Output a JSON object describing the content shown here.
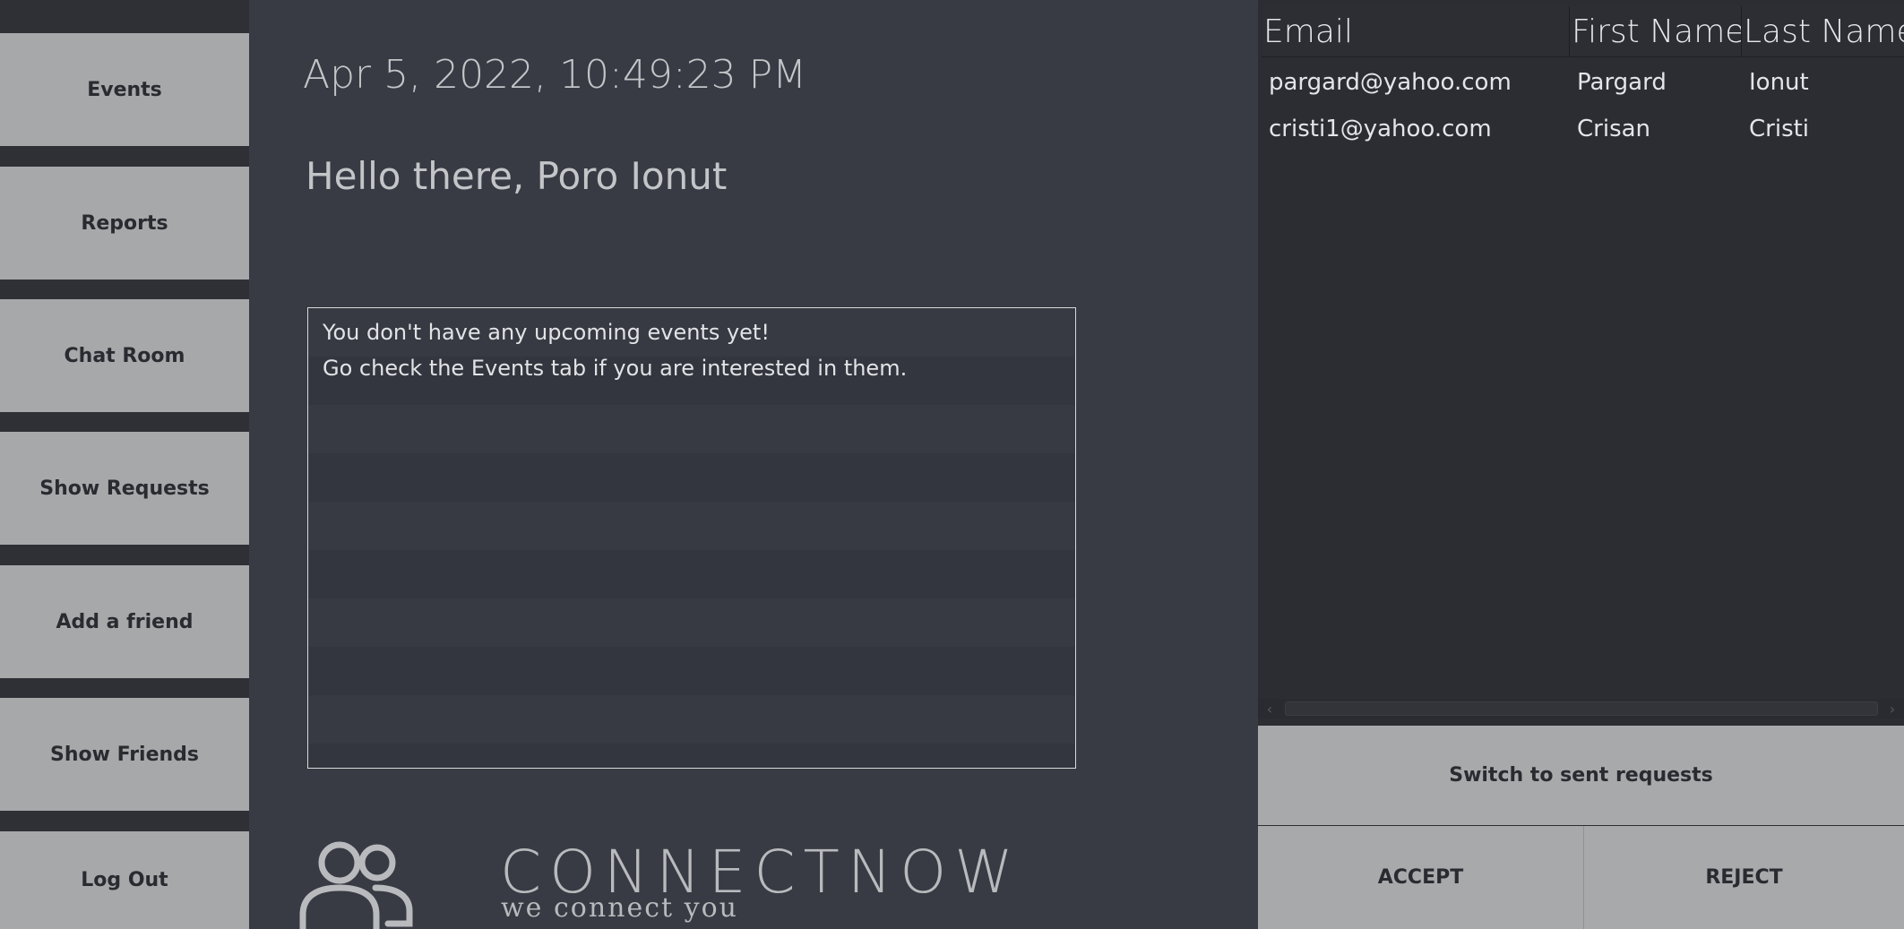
{
  "sidebar": {
    "items": [
      {
        "label": "Events"
      },
      {
        "label": "Reports"
      },
      {
        "label": "Chat Room"
      },
      {
        "label": "Show Requests"
      },
      {
        "label": "Add a friend"
      },
      {
        "label": "Show Friends"
      },
      {
        "label": "Log Out"
      }
    ]
  },
  "main": {
    "datetime": "Apr 5, 2022, 10:49:23 PM",
    "greeting": "Hello there, Poro Ionut",
    "events_message": [
      "You don't have any upcoming events yet!",
      "Go check the Events tab if you are interested in them."
    ]
  },
  "logo": {
    "name": "CONNECTNOW",
    "tagline": "we connect you",
    "icon": "people-icon"
  },
  "requests": {
    "columns": [
      "Email",
      "First Name",
      "Last Name"
    ],
    "rows": [
      [
        "pargard@yahoo.com",
        "Pargard",
        "Ionut"
      ],
      [
        "cristi1@yahoo.com",
        "Crisan",
        "Cristi"
      ]
    ],
    "switch_label": "Switch to sent requests",
    "accept_label": "ACCEPT",
    "reject_label": "REJECT"
  }
}
